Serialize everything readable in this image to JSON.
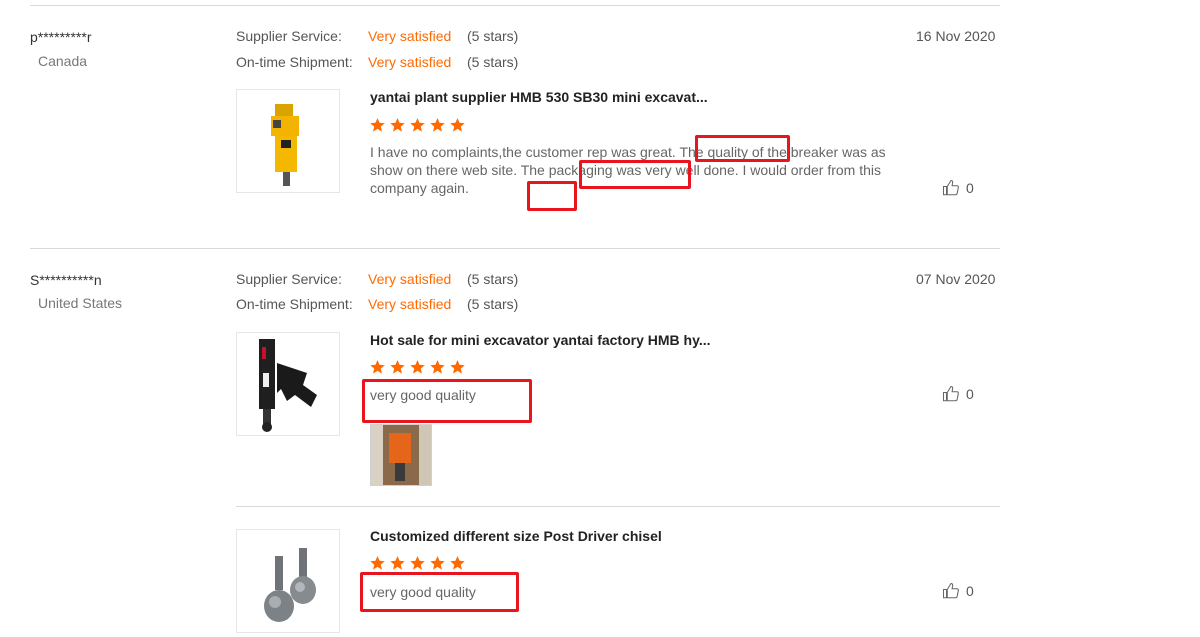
{
  "reviews": [
    {
      "reviewer": "p*********r",
      "country": "Canada",
      "date": "16 Nov 2020",
      "supplier_service_label": "Supplier Service:",
      "supplier_service_value": "Very satisfied",
      "supplier_service_stars": "(5 stars)",
      "shipment_label": "On-time Shipment:",
      "shipment_value": "Very satisfied",
      "shipment_stars": "(5 stars)",
      "items": [
        {
          "product_title": "yantai plant supplier HMB 530 SB30 mini excavat...",
          "rating": 5,
          "review_text": "I have no complaints,the customer rep was great. The  quality of the breaker was as show on there web site. The packaging was very well done. I would order from this company again.",
          "likes": "0"
        }
      ]
    },
    {
      "reviewer": "S**********n",
      "country": "United States",
      "date": "07 Nov 2020",
      "supplier_service_label": "Supplier Service:",
      "supplier_service_value": "Very satisfied",
      "supplier_service_stars": "(5 stars)",
      "shipment_label": "On-time Shipment:",
      "shipment_value": "Very satisfied",
      "shipment_stars": "(5 stars)",
      "items": [
        {
          "product_title": "Hot sale for mini excavator yantai factory HMB hy...",
          "rating": 5,
          "review_text": "very good quality",
          "likes": "0"
        },
        {
          "product_title": "Customized different size Post Driver chisel",
          "rating": 5,
          "review_text": "very good quality",
          "likes": "0"
        }
      ]
    }
  ],
  "colors": {
    "accent": "#ff6a00",
    "highlight_box": "#e8141e",
    "divider": "#d9d9d9"
  },
  "icons": {
    "star": "star-icon",
    "like": "thumbs-up-icon"
  }
}
